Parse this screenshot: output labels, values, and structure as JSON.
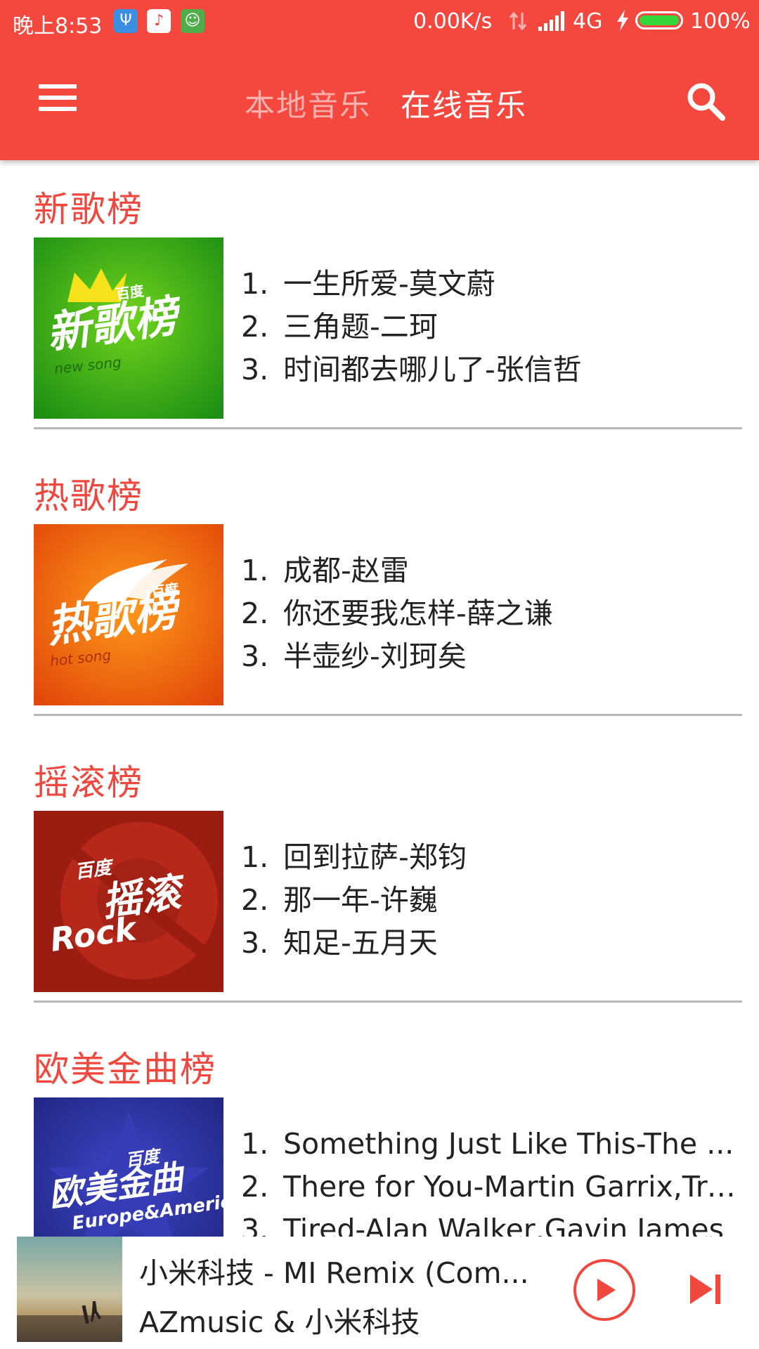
{
  "status_bar": {
    "time": "晚上8:53",
    "net_speed": "0.00K/s",
    "network": "4G",
    "battery": "100%",
    "battery_level": 100,
    "icons": [
      "usb-icon",
      "music-notification-icon",
      "android-debug-icon",
      "data-transfer-arrows-icon",
      "signal-strength-icon",
      "charging-bolt-icon",
      "battery-icon"
    ]
  },
  "toolbar": {
    "menu_icon": "hamburger-menu-icon",
    "tabs": [
      {
        "label": "本地音乐",
        "active": false
      },
      {
        "label": "在线音乐",
        "active": true
      }
    ],
    "search_icon": "search-icon"
  },
  "colors": {
    "primary": "#f4473e",
    "section_title": "#f0473e",
    "divider": "#b8b8b8",
    "text": "#222222"
  },
  "charts": [
    {
      "title": "新歌榜",
      "cover": {
        "brand": "百度",
        "name": "新歌榜",
        "sub": "new song",
        "color": "#3faf1e"
      },
      "songs": [
        {
          "num": "1.",
          "text": "一生所爱-莫文蔚"
        },
        {
          "num": "2.",
          "text": "三角题-二珂"
        },
        {
          "num": "3.",
          "text": "时间都去哪儿了-张信哲"
        }
      ]
    },
    {
      "title": "热歌榜",
      "cover": {
        "brand": "百度",
        "name": "热歌榜",
        "sub": "hot song",
        "color": "#f06a0e"
      },
      "songs": [
        {
          "num": "1.",
          "text": "成都-赵雷"
        },
        {
          "num": "2.",
          "text": "你还要我怎样-薛之谦"
        },
        {
          "num": "3.",
          "text": "半壶纱-刘珂矣"
        }
      ]
    },
    {
      "title": "摇滚榜",
      "cover": {
        "brand": "百度",
        "name": "摇滚",
        "sub": "Rock",
        "color": "#9b1d12"
      },
      "songs": [
        {
          "num": "1.",
          "text": "回到拉萨-郑钧"
        },
        {
          "num": "2.",
          "text": "那一年-许巍"
        },
        {
          "num": "3.",
          "text": "知足-五月天"
        }
      ]
    },
    {
      "title": "欧美金曲榜",
      "cover": {
        "brand": "百度",
        "name": "欧美金曲",
        "sub": "Europe&America",
        "color": "#2b2f9e"
      },
      "songs": [
        {
          "num": "1.",
          "text": "Something Just Like This-The ..."
        },
        {
          "num": "2.",
          "text": "There for You-Martin Garrix,Tro..."
        },
        {
          "num": "3.",
          "text": "Tired-Alan Walker,Gavin James"
        }
      ]
    }
  ],
  "player": {
    "title": "小米科技 - MI Remix (Com...",
    "artist": "AZmusic & 小米科技",
    "play_icon": "play-icon",
    "next_icon": "skip-next-icon"
  }
}
